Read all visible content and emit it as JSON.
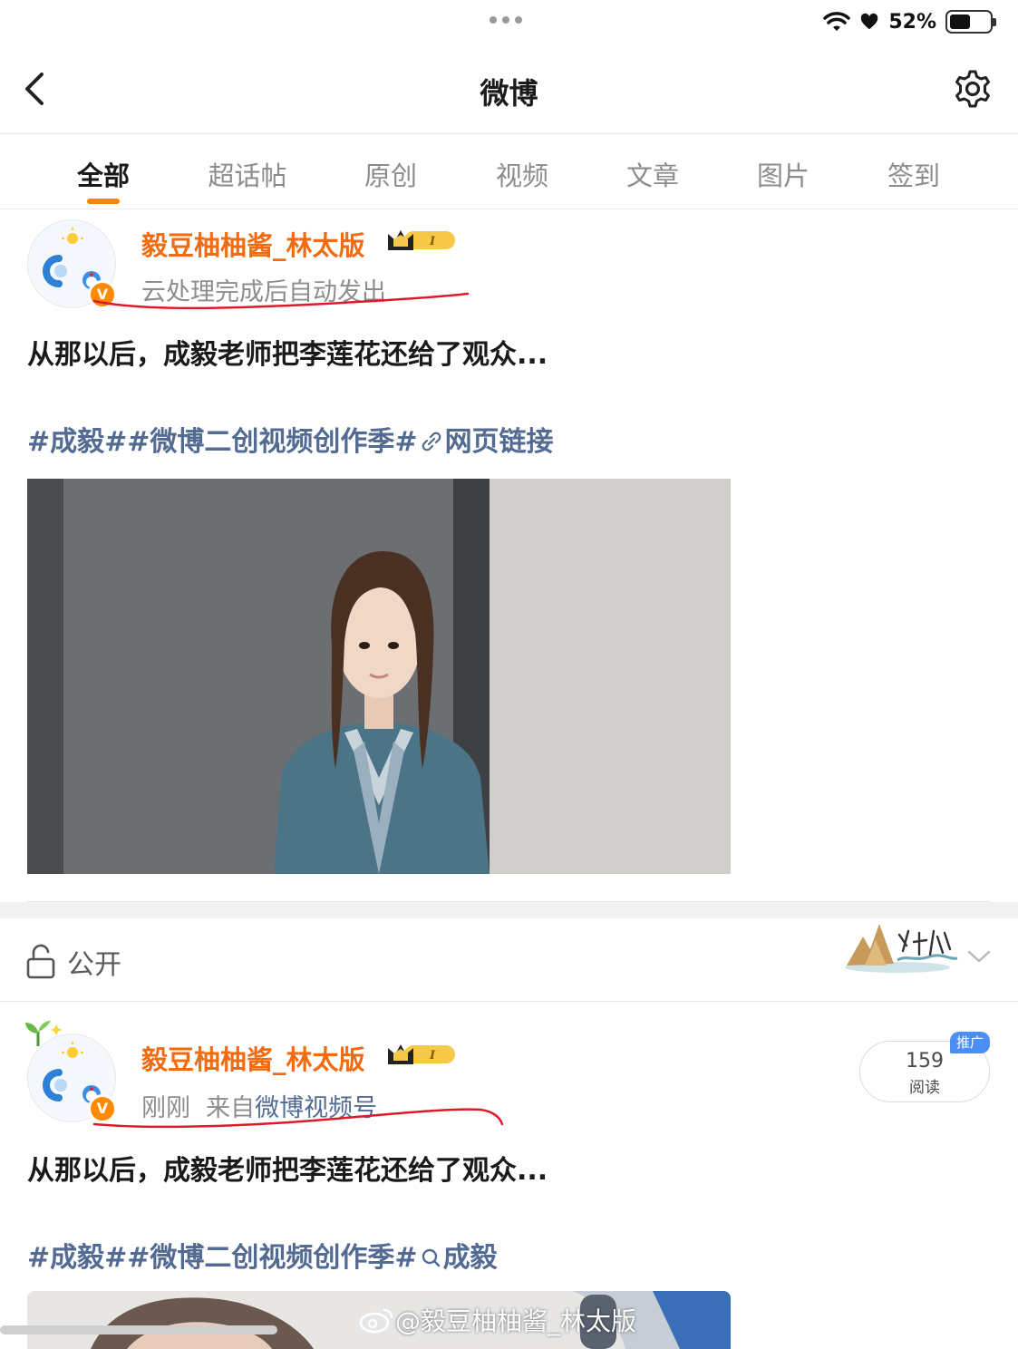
{
  "status_bar": {
    "battery_text": "52%",
    "battery_level": 0.52
  },
  "nav": {
    "title": "微博",
    "back_icon": "chevron-left-icon",
    "settings_icon": "gear-icon"
  },
  "tabs": [
    {
      "label": "全部",
      "active": true
    },
    {
      "label": "超话帖",
      "active": false
    },
    {
      "label": "原创",
      "active": false
    },
    {
      "label": "视频",
      "active": false
    },
    {
      "label": "文章",
      "active": false
    },
    {
      "label": "图片",
      "active": false
    },
    {
      "label": "签到",
      "active": false
    }
  ],
  "posts": [
    {
      "username": "毅豆柚柚酱_林太版",
      "meta": "云处理完成后自动发出",
      "text": "从那以后，成毅老师把李莲花还给了观众...",
      "topics": {
        "tag1": "#成毅#",
        "tag2": "#微博二创视频创作季#",
        "link_label": "网页链接"
      }
    },
    {
      "username": "毅豆柚柚酱_林太版",
      "meta_time": "刚刚",
      "meta_from": "来自",
      "meta_source": "微博视频号",
      "text": "从那以后，成毅老师把李莲花还给了观众...",
      "topics": {
        "tag1": "#成毅#",
        "tag2": "#微博二创视频创作季#",
        "search_label": "成毅"
      },
      "read_count": "159",
      "read_label": "阅读",
      "promo_label": "推广"
    }
  ],
  "visibility": {
    "label": "公开"
  },
  "watermark": "@毅豆柚柚酱_林太版",
  "colors": {
    "accent_orange": "#ff8200",
    "username": "#f26b11",
    "topic_link": "#536b93",
    "annotation_red": "#e0192a",
    "promo_blue": "#4b8ff5"
  }
}
